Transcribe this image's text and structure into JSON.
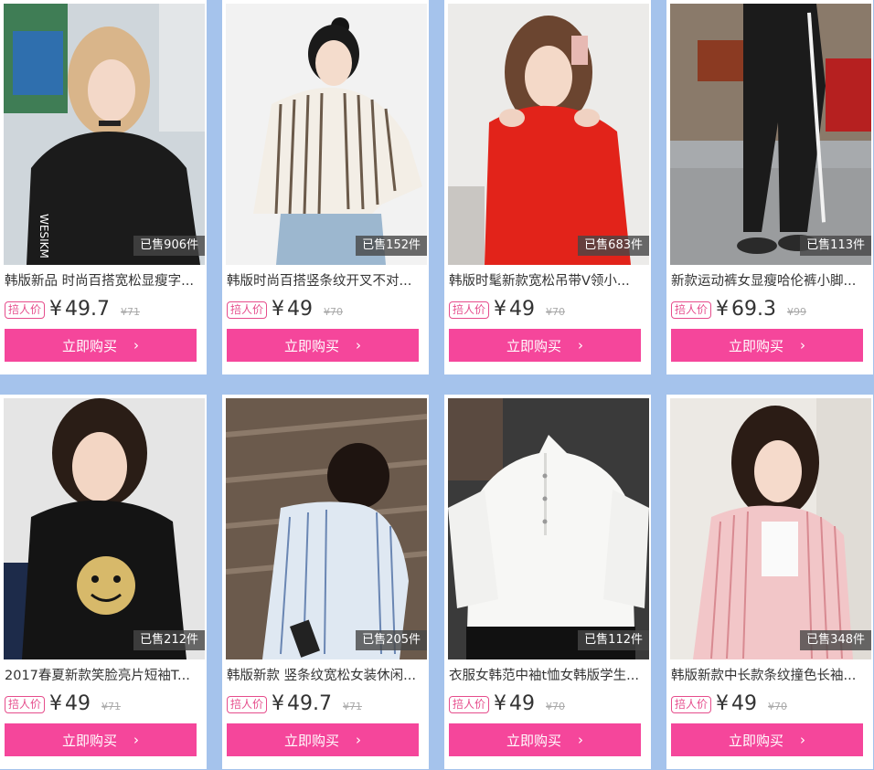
{
  "products": [
    {
      "title": "韩版新品 时尚百搭宽松显瘦字...",
      "tag": "掊人价",
      "currency": "¥",
      "price": "49.7",
      "old_price": "¥71",
      "sold": "已售906件",
      "buy_label": "立即购买",
      "image": "model-black-sweatshirt"
    },
    {
      "title": "韩版时尚百搭竖条纹开叉不对...",
      "tag": "掊人价",
      "currency": "¥",
      "price": "49",
      "old_price": "¥70",
      "sold": "已售152件",
      "buy_label": "立即购买",
      "image": "model-striped-vneck-shirt"
    },
    {
      "title": "韩版时髦新款宽松吊带V领小...",
      "tag": "掊人价",
      "currency": "¥",
      "price": "49",
      "old_price": "¥70",
      "sold": "已售683件",
      "buy_label": "立即购买",
      "image": "model-red-cold-shoulder-top"
    },
    {
      "title": "新款运动裤女显瘦哈伦裤小脚...",
      "tag": "掊人价",
      "currency": "¥",
      "price": "69.3",
      "old_price": "¥99",
      "sold": "已售113件",
      "buy_label": "立即购买",
      "image": "model-black-track-pants"
    },
    {
      "title": "2017春夏新款笑脸亮片短袖T...",
      "tag": "掊人价",
      "currency": "¥",
      "price": "49",
      "old_price": "¥71",
      "sold": "已售212件",
      "buy_label": "立即购买",
      "image": "model-smiley-tshirt"
    },
    {
      "title": "韩版新款 竖条纹宽松女装休闲...",
      "tag": "掊人价",
      "currency": "¥",
      "price": "49.7",
      "old_price": "¥71",
      "sold": "已售205件",
      "buy_label": "立即购买",
      "image": "model-blue-striped-shirt"
    },
    {
      "title": "衣服女韩范中袖t恤女韩版学生...",
      "tag": "掊人价",
      "currency": "¥",
      "price": "49",
      "old_price": "¥70",
      "sold": "已售112件",
      "buy_label": "立即购买",
      "image": "white-halfsleeve-blouse"
    },
    {
      "title": "韩版新款中长款条纹撞色长袖...",
      "tag": "掊人价",
      "currency": "¥",
      "price": "49",
      "old_price": "¥70",
      "sold": "已售348件",
      "buy_label": "立即购买",
      "image": "model-pink-striped-shirt"
    }
  ]
}
